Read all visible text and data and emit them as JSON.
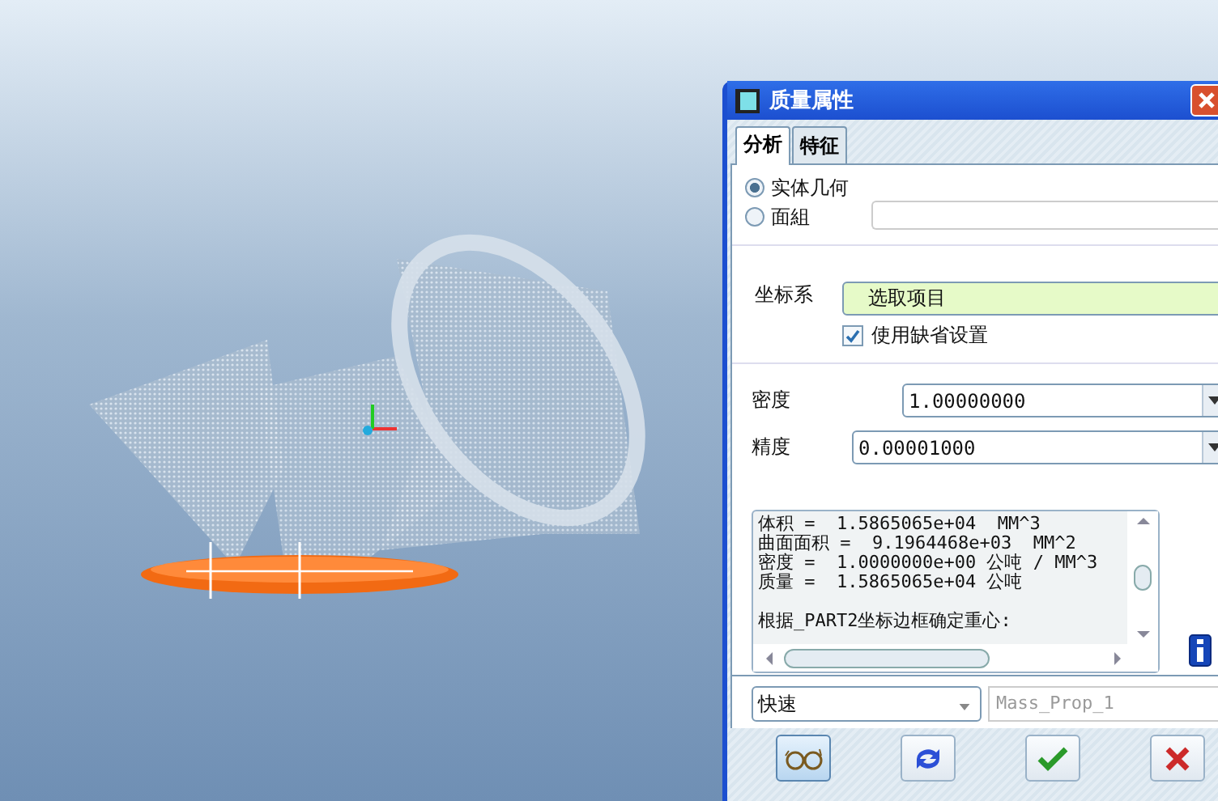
{
  "dialog": {
    "title": "质量属性",
    "tabs": [
      {
        "label": "分析",
        "selected": true
      },
      {
        "label": "特征",
        "selected": false
      }
    ],
    "geometry_options": [
      {
        "label": "实体几何",
        "selected": true
      },
      {
        "label": "面組",
        "selected": false
      }
    ],
    "coordinate_system": {
      "label": "坐标系",
      "value": "选取项目"
    },
    "use_default": {
      "label": "使用缺省设置",
      "checked": true
    },
    "density": {
      "label": "密度",
      "value": "1.00000000"
    },
    "precision": {
      "label": "精度",
      "value": "0.00001000"
    },
    "results": [
      "体积 =  1.5865065e+04  MM^3",
      "曲面面积 =  9.1964468e+03  MM^2",
      "密度 =  1.0000000e+00 公吨 / MM^3",
      "质量 =  1.5865065e+04 公吨"
    ],
    "center_of_gravity_note": "根据_PART2坐标边框确定重心:",
    "mode": "快速",
    "name": "Mass_Prop_1"
  }
}
